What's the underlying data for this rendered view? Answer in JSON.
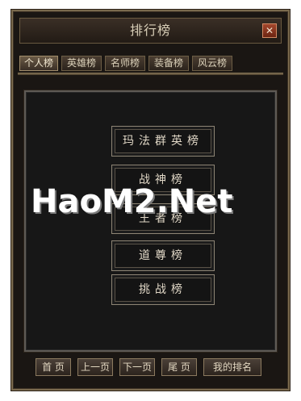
{
  "window": {
    "title": "排行榜",
    "close_icon": "close-icon",
    "close_glyph": "✕"
  },
  "tabs": [
    {
      "label": "个人榜",
      "active": true
    },
    {
      "label": "英雄榜",
      "active": false
    },
    {
      "label": "名师榜",
      "active": false
    },
    {
      "label": "装备榜",
      "active": false
    },
    {
      "label": "风云榜",
      "active": false
    }
  ],
  "rankings": [
    {
      "label": "玛法群英榜"
    },
    {
      "label": "战神榜"
    },
    {
      "label": "王者榜"
    },
    {
      "label": "道尊榜"
    },
    {
      "label": "挑战榜"
    }
  ],
  "footer": {
    "first": "首 页",
    "prev": "上一页",
    "next": "下一页",
    "last": "尾 页",
    "my_rank": "我的排名"
  },
  "watermark": "HaoM2.Net",
  "colors": {
    "panel_bg": "#1a1613",
    "border_gold": "#7a6a4e",
    "text_light": "#d8ceb7",
    "close_red": "#a3472d",
    "content_bg": "#171717"
  }
}
